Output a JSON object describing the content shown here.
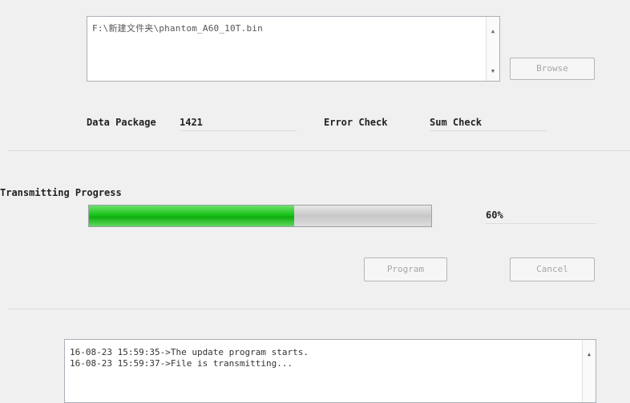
{
  "file": {
    "path": "F:\\新建文件夹\\phantom_A60_10T.bin",
    "browse_label": "Browse"
  },
  "info": {
    "data_package_label": "Data Package",
    "data_package_value": "1421",
    "error_check_label": "Error Check",
    "error_check_value": "Sum Check"
  },
  "progress": {
    "label": "Transmitting Progress",
    "percent_text": "60%",
    "fraction": 0.6
  },
  "buttons": {
    "program_label": "Program",
    "cancel_label": "Cancel"
  },
  "log": {
    "lines": [
      "16-08-23 15:59:35->The update program starts.",
      "16-08-23 15:59:37->File is transmitting..."
    ]
  },
  "colors": {
    "progress_green": "#18c418",
    "window_bg": "#f0f0f0"
  }
}
